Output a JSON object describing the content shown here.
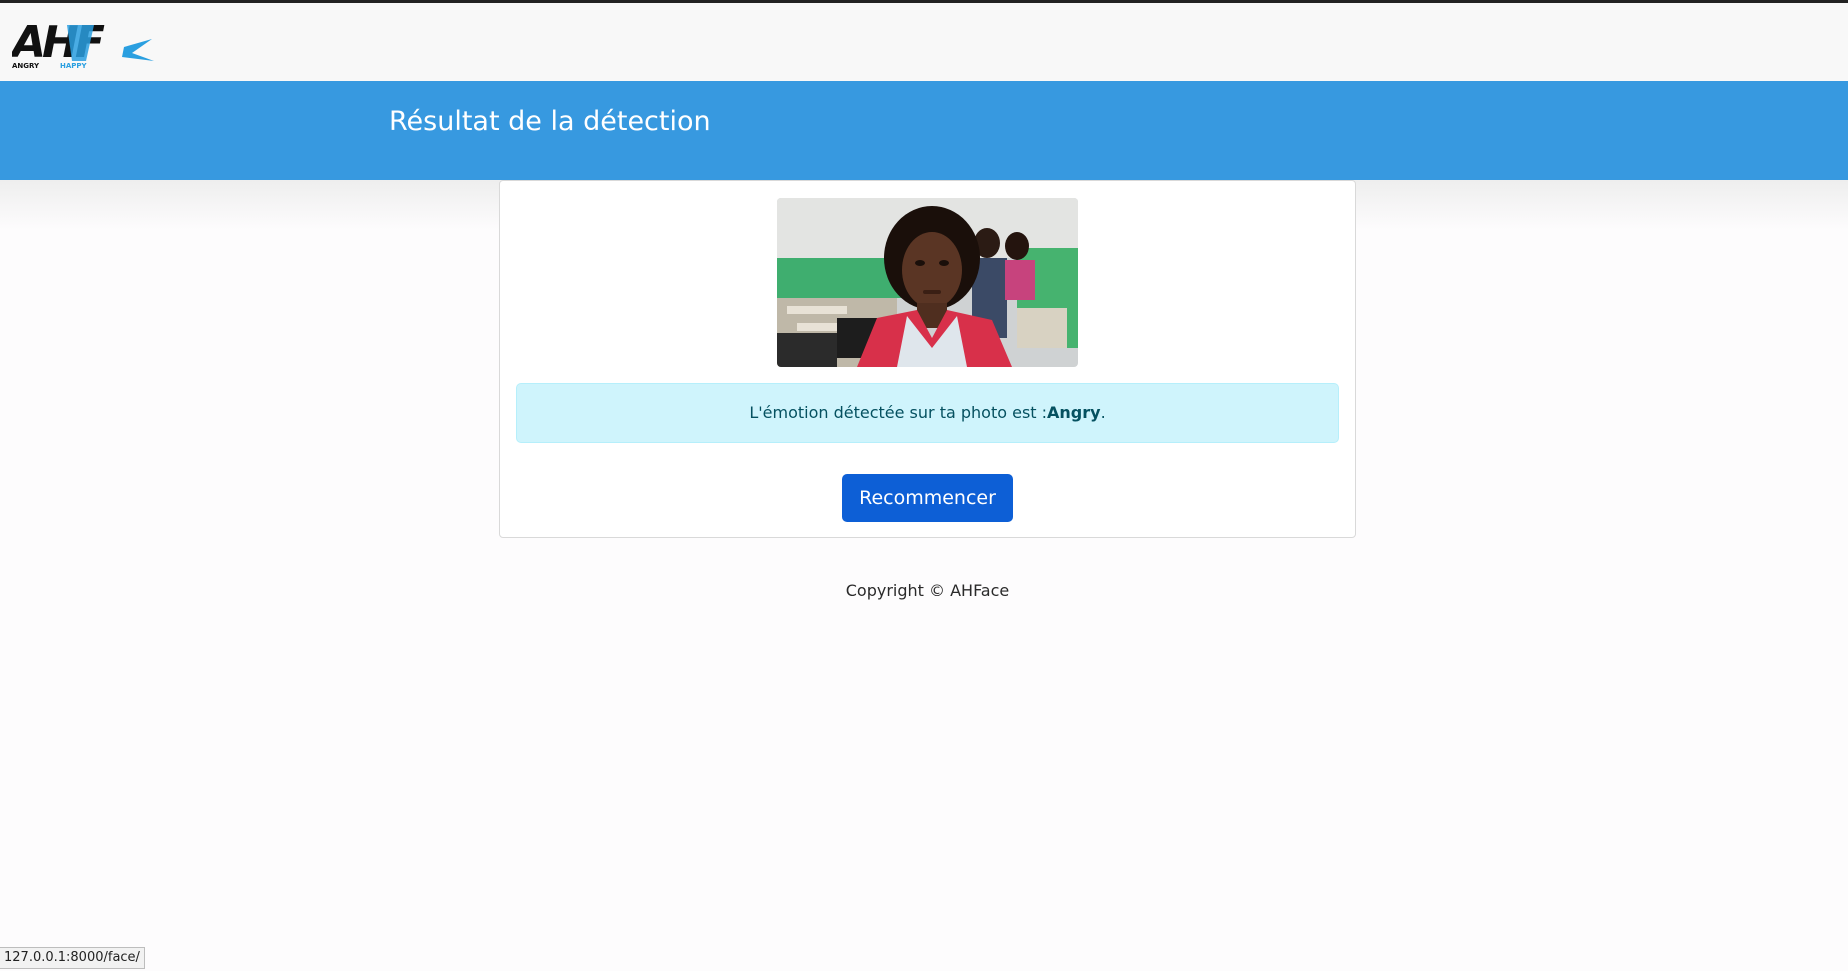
{
  "brand": {
    "logo_text": "AHF",
    "logo_sub_left": "ANGRY",
    "logo_sub_right": "HAPPY"
  },
  "header": {
    "title": "Résultat de la détection"
  },
  "result": {
    "message_prefix": "L'émotion détectée sur ta photo est :",
    "emotion": "Angry",
    "message_suffix": ".",
    "restart_label": "Recommencer"
  },
  "footer": {
    "copyright": "Copyright © AHFace"
  },
  "status_bar": {
    "url": "127.0.0.1:8000/face/"
  },
  "colors": {
    "header_blue": "#3799e0",
    "alert_bg": "#cff4fc",
    "alert_text": "#055160",
    "button_blue": "#0d5fd6"
  }
}
